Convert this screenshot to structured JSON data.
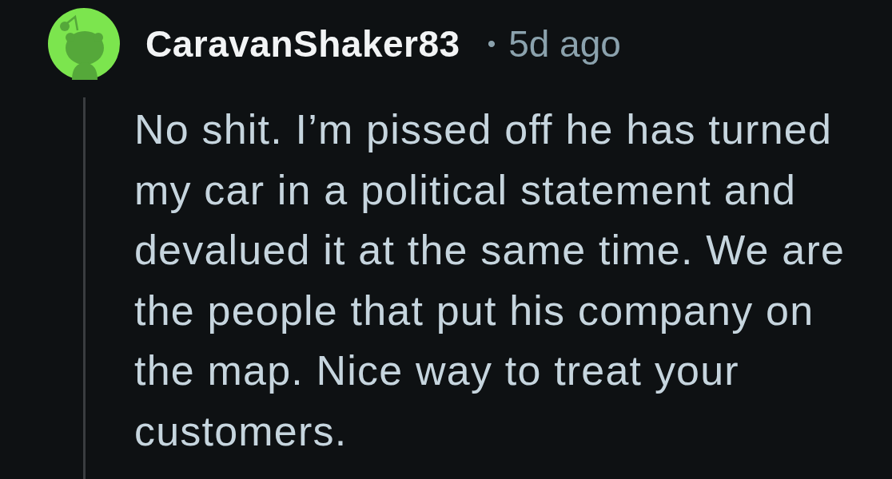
{
  "comment": {
    "author": "CaravanShaker83",
    "separator": "•",
    "time": "5d ago",
    "body": "No shit. I’m pissed off he has turned my car in a political statement and devalued it at the same time. We are the people that put his company on the map. Nice way to treat your customers."
  }
}
